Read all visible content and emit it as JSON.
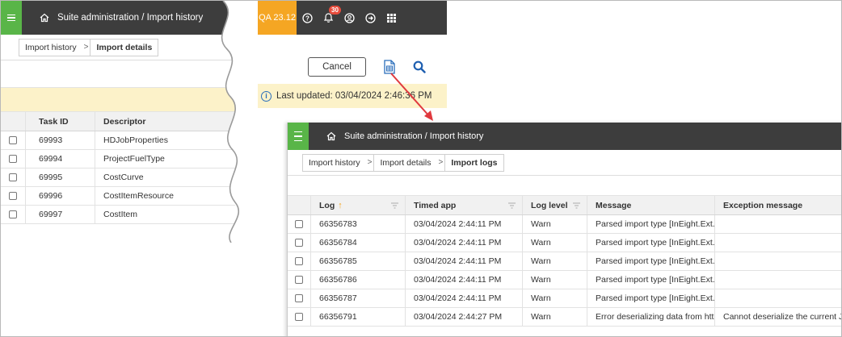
{
  "back_left": {
    "breadcrumb": "Suite administration  /  Import history",
    "tabs": [
      "Import history",
      "Import details"
    ],
    "grid": {
      "columns": [
        "Task ID",
        "Descriptor"
      ],
      "rows": [
        [
          "69993",
          "HDJobProperties"
        ],
        [
          "69994",
          "ProjectFuelType"
        ],
        [
          "69995",
          "CostCurve"
        ],
        [
          "69996",
          "CostItemResource"
        ],
        [
          "69997",
          "CostItem"
        ]
      ]
    }
  },
  "back_right": {
    "version": "QA 23.12",
    "notification_count": "30",
    "cancel_label": "Cancel",
    "last_updated": "Last updated: 03/04/2024 2:46:36 PM"
  },
  "front": {
    "breadcrumb": "Suite administration  /  Import history",
    "tabs": [
      "Import history",
      "Import details",
      "Import logs"
    ],
    "grid": {
      "columns": [
        "Log",
        "Timed app",
        "Log level",
        "Message",
        "Exception message"
      ],
      "rows": [
        [
          "66356783",
          "03/04/2024 2:44:11 PM",
          "Warn",
          "Parsed import type [InEight.Ext...",
          ""
        ],
        [
          "66356784",
          "03/04/2024 2:44:11 PM",
          "Warn",
          "Parsed import type [InEight.Ext...",
          ""
        ],
        [
          "66356785",
          "03/04/2024 2:44:11 PM",
          "Warn",
          "Parsed import type [InEight.Ext...",
          ""
        ],
        [
          "66356786",
          "03/04/2024 2:44:11 PM",
          "Warn",
          "Parsed import type [InEight.Ext...",
          ""
        ],
        [
          "66356787",
          "03/04/2024 2:44:11 PM",
          "Warn",
          "Parsed import type [InEight.Ext...",
          ""
        ],
        [
          "66356791",
          "03/04/2024 2:44:27 PM",
          "Warn",
          "Error deserializing data from htt...",
          "Cannot deserialize the current J..."
        ]
      ]
    }
  },
  "colors": {
    "accent_green": "#59b548",
    "topbar": "#3d3d3d",
    "version_orange": "#f5a623",
    "notice_yellow": "#fcf2c9",
    "arrow_red": "#e0393e"
  },
  "icons": [
    "hamburger-icon",
    "home-icon",
    "help-icon",
    "bell-icon",
    "user-icon",
    "logout-icon",
    "apps-grid-icon",
    "document-icon",
    "search-icon",
    "info-icon",
    "filter-icon",
    "sort-asc-icon"
  ]
}
